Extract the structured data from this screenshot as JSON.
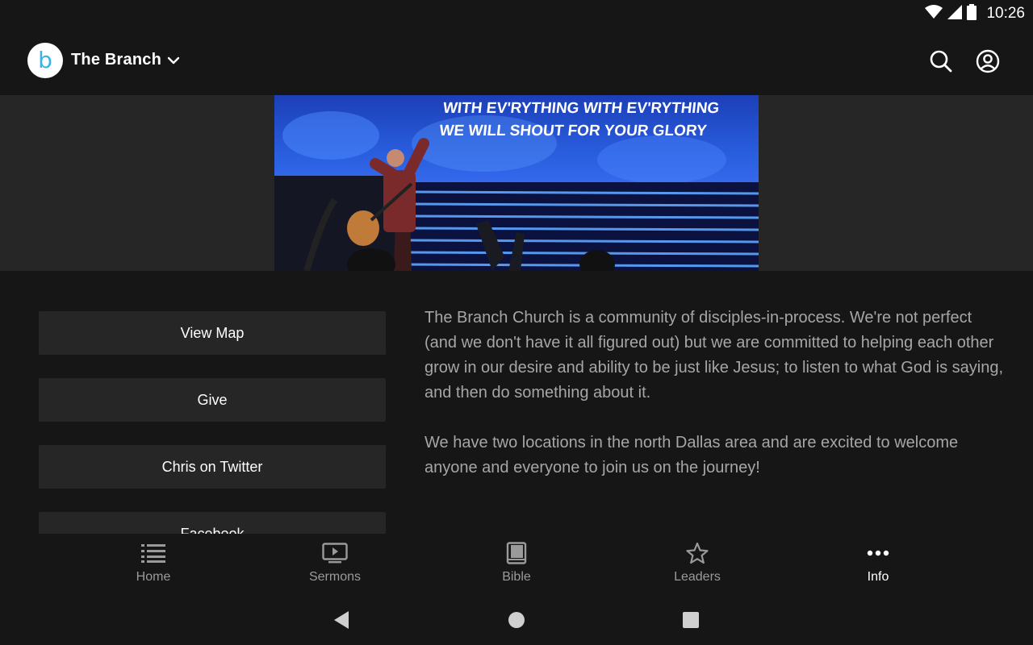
{
  "status_bar": {
    "time": "10:26",
    "icons": [
      "wifi-icon",
      "cellular-icon",
      "battery-icon"
    ]
  },
  "app_bar": {
    "title": "The Branch",
    "logo_letter": "b",
    "icons": [
      "chevron-down-icon",
      "search-icon",
      "account-icon"
    ]
  },
  "hero": {
    "lyrics_line_1": "WITH EV'RYTHING WITH EV'RYTHING",
    "lyrics_line_2": "WE WILL SHOUT FOR YOUR GLORY"
  },
  "actions": [
    {
      "label": "View Map"
    },
    {
      "label": "Give"
    },
    {
      "label": "Chris on Twitter"
    },
    {
      "label": "Facebook"
    }
  ],
  "description": {
    "paragraph_1": "The Branch Church is a community of disciples-in-process.  We're not perfect (and we don't have it all figured out) but we are committed to helping each other grow in our desire and ability to be just like Jesus; to listen to what God is saying, and then do something about it.",
    "paragraph_2": "We have two locations in the north Dallas area and are excited to welcome anyone and everyone to join us on the journey!"
  },
  "bottom_nav": {
    "items": [
      {
        "label": "Home",
        "icon": "list-icon"
      },
      {
        "label": "Sermons",
        "icon": "video-icon"
      },
      {
        "label": "Bible",
        "icon": "book-icon"
      },
      {
        "label": "Leaders",
        "icon": "star-icon"
      },
      {
        "label": "Info",
        "icon": "more-icon"
      }
    ],
    "active": "Info"
  },
  "colors": {
    "background": "#161616",
    "surface": "#262626",
    "accent": "#3db3e3",
    "text_secondary": "#a6a6a6"
  }
}
